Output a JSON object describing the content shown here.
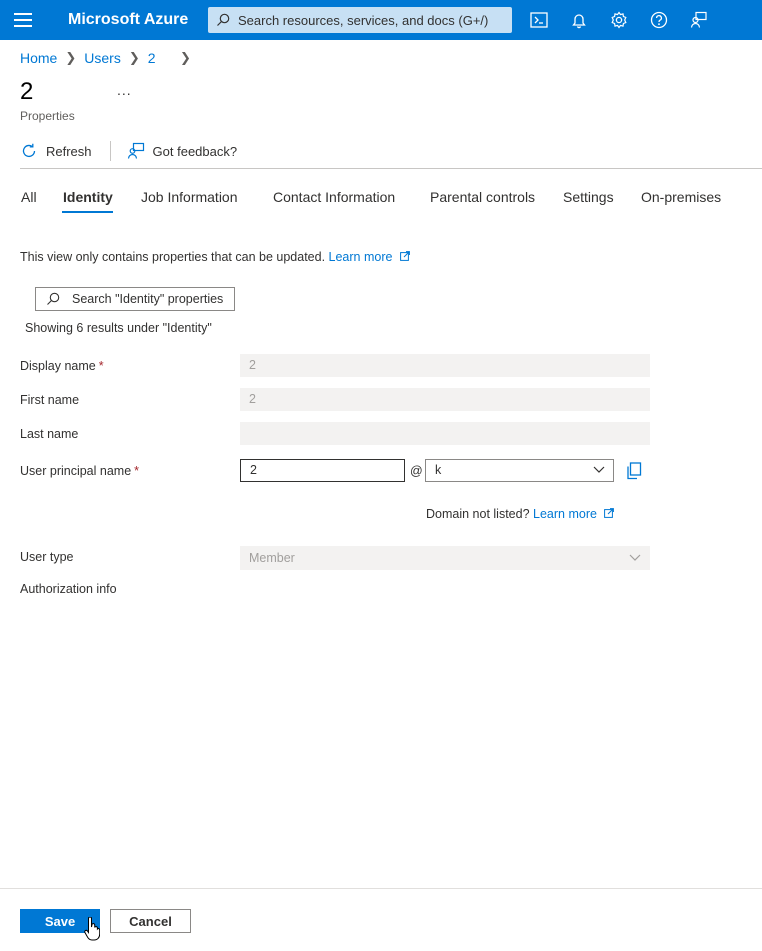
{
  "topbar": {
    "brand": "Microsoft Azure",
    "search_placeholder": "Search resources, services, and docs (G+/)",
    "icons": [
      "cloud-shell-icon",
      "bell-icon",
      "gear-icon",
      "help-icon",
      "feedback-icon"
    ],
    "color": "#0078d4"
  },
  "breadcrumb": {
    "items": [
      "Home",
      "Users",
      "2"
    ]
  },
  "page": {
    "title": "2",
    "more": "...",
    "subtitle": "Properties"
  },
  "toolbar": {
    "refresh": "Refresh",
    "feedback": "Got feedback?"
  },
  "tabs": [
    {
      "label": "All",
      "active": false
    },
    {
      "label": "Identity",
      "active": true
    },
    {
      "label": "Job Information",
      "active": false
    },
    {
      "label": "Contact Information",
      "active": false
    },
    {
      "label": "Parental controls",
      "active": false
    },
    {
      "label": "Settings",
      "active": false
    },
    {
      "label": "On-premises",
      "active": false
    }
  ],
  "info": {
    "text": "This view only contains properties that can be updated.",
    "link": "Learn more"
  },
  "filter": {
    "placeholder": "Search \"Identity\" properties",
    "results": "Showing 6 results under \"Identity\""
  },
  "form": {
    "display_name": {
      "label": "Display name",
      "required": "*",
      "value": "2"
    },
    "first_name": {
      "label": "First name",
      "value": "2"
    },
    "last_name": {
      "label": "Last name",
      "value": ""
    },
    "upn": {
      "label": "User principal name",
      "required": "*",
      "value": "2",
      "at": "@",
      "domain": "k"
    },
    "domain_note": {
      "text": "Domain not listed?",
      "link": "Learn more"
    },
    "user_type": {
      "label": "User type",
      "value": "Member"
    },
    "authorization": {
      "label": "Authorization info"
    }
  },
  "footer": {
    "save": "Save",
    "cancel": "Cancel"
  }
}
